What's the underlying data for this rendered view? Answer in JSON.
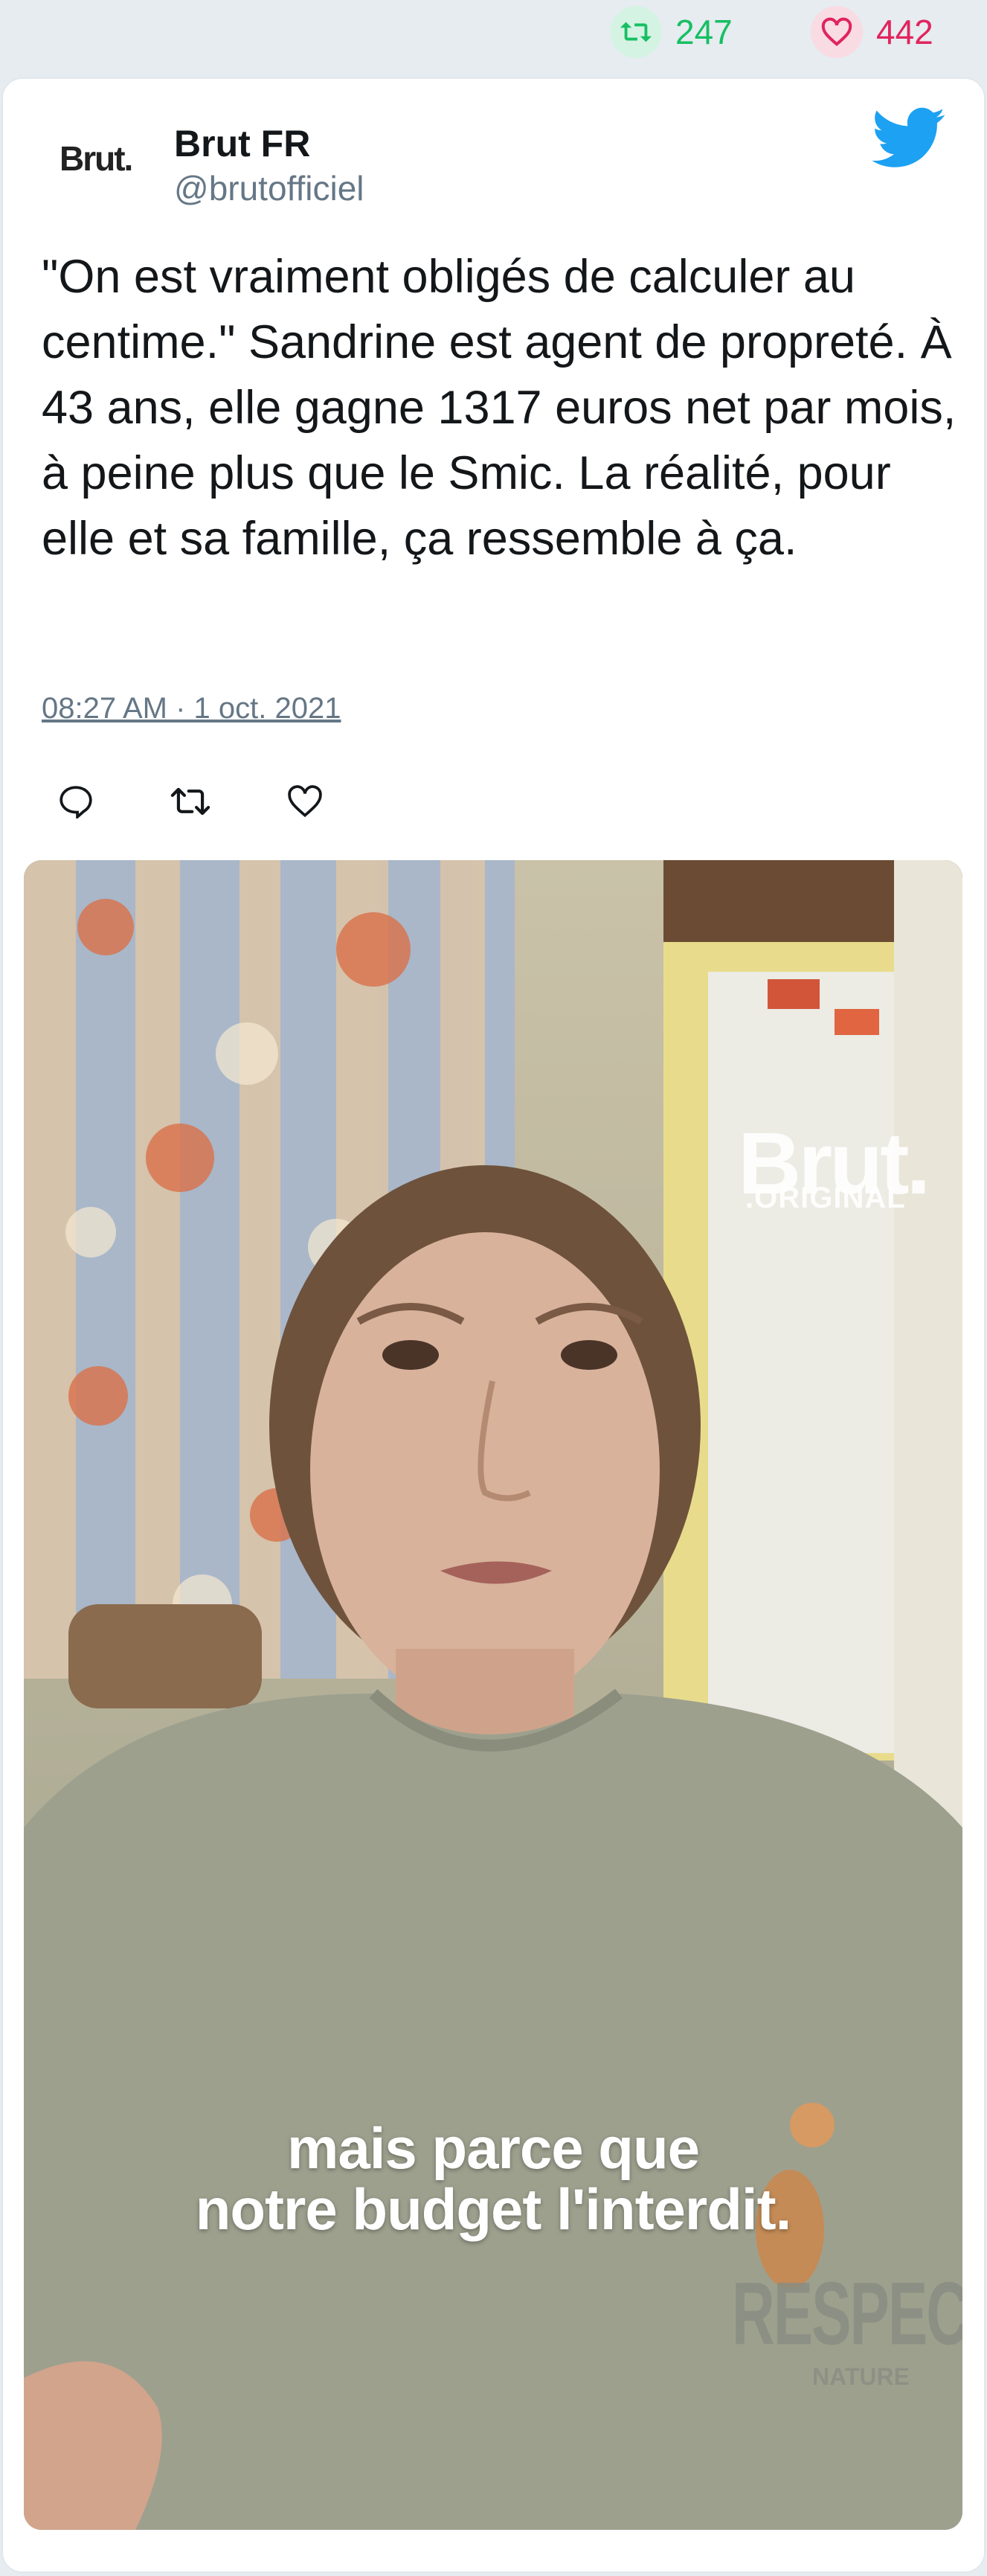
{
  "stats": {
    "retweets": "247",
    "likes": "442"
  },
  "author": {
    "avatar_text": "Brut.",
    "name": "Brut FR",
    "handle": "@brutofficiel"
  },
  "tweet": {
    "text": "\"On est vraiment obligés de calculer au centime.\" Sandrine est agent de propreté. À 43 ans, elle gagne 1317 euros net par mois, à peine plus que le Smic. La réalité, pour elle et sa famille, ça ressemble à ça.",
    "timestamp": "08:27 AM · 1 oct. 2021"
  },
  "media": {
    "watermark": "Brut.",
    "watermark_sub": ".ORIGINAL",
    "caption_line1": "mais parce que",
    "caption_line2": "notre budget l'interdit.",
    "shirt_text": "RESPECT",
    "shirt_sub": "NATURE"
  },
  "colors": {
    "retweet": "#17bf63",
    "like": "#e0245e",
    "twitter_blue": "#1da1f2",
    "secondary_text": "#657786"
  }
}
